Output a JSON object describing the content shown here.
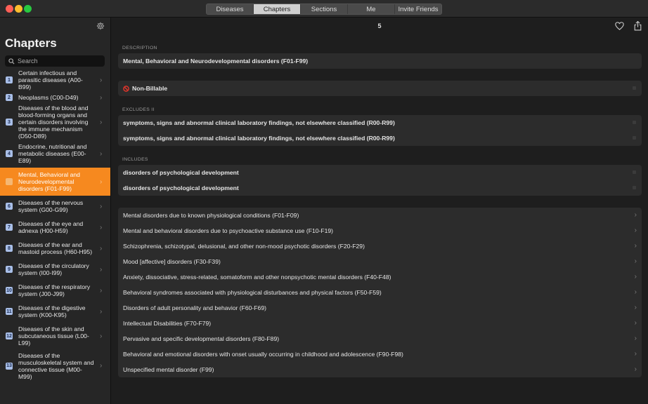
{
  "tabs": [
    {
      "label": "Diseases"
    },
    {
      "label": "Chapters"
    },
    {
      "label": "Sections"
    },
    {
      "label": "Me"
    },
    {
      "label": "Invite Friends"
    }
  ],
  "sidebar": {
    "title": "Chapters",
    "search_placeholder": "Search",
    "items": [
      {
        "num": "1",
        "label": "Certain infectious and parasitic diseases (A00-B99)"
      },
      {
        "num": "2",
        "label": "Neoplasms (C00-D49)"
      },
      {
        "num": "3",
        "label": "Diseases of the blood and blood-forming organs and certain disorders involving the immune mechanism (D50-D89)"
      },
      {
        "num": "4",
        "label": "Endocrine, nutritional and metabolic diseases (E00-E89)"
      },
      {
        "num": "5",
        "label": "Mental, Behavioral and Neurodevelopmental disorders (F01-F99)"
      },
      {
        "num": "6",
        "label": "Diseases of the nervous system (G00-G99)"
      },
      {
        "num": "7",
        "label": "Diseases of the eye and adnexa (H00-H59)"
      },
      {
        "num": "8",
        "label": "Diseases of the ear and mastoid process (H60-H95)"
      },
      {
        "num": "9",
        "label": "Diseases of the circulatory system (I00-I99)"
      },
      {
        "num": "10",
        "label": "Diseases of the respiratory system (J00-J99)"
      },
      {
        "num": "11",
        "label": "Diseases of the digestive system (K00-K95)"
      },
      {
        "num": "12",
        "label": "Diseases of the skin and subcutaneous tissue (L00-L99)"
      },
      {
        "num": "13",
        "label": "Diseases of the musculoskeletal system and connective tissue (M00-M99)"
      }
    ]
  },
  "main": {
    "page_number": "5",
    "description_label": "DESCRIPTION",
    "description": "Mental, Behavioral and Neurodevelopmental disorders (F01-F99)",
    "billable": "Non-Billable",
    "excludes_label": "EXCLUDES II",
    "excludes": [
      "symptoms, signs and abnormal clinical laboratory findings, not elsewhere classified (R00-R99)",
      "symptoms, signs and abnormal clinical laboratory findings, not elsewhere classified (R00-R99)"
    ],
    "includes_label": "INCLUDES",
    "includes": [
      "disorders of psychological development",
      "disorders of psychological development"
    ],
    "sections": [
      "Mental disorders due to known physiological conditions (F01-F09)",
      "Mental and behavioral disorders due to psychoactive substance use (F10-F19)",
      "Schizophrenia, schizotypal, delusional, and other non-mood psychotic disorders (F20-F29)",
      "Mood [affective] disorders (F30-F39)",
      "Anxiety, dissociative, stress-related, somatoform and other nonpsychotic mental disorders (F40-F48)",
      "Behavioral syndromes associated with physiological disturbances and physical factors (F50-F59)",
      "Disorders of adult personality and behavior (F60-F69)",
      "Intellectual Disabilities (F70-F79)",
      "Pervasive and specific developmental disorders (F80-F89)",
      "Behavioral and emotional disorders with onset usually occurring in childhood and adolescence (F90-F98)",
      "Unspecified mental disorder (F99)"
    ]
  },
  "icons": [
    "gear-icon",
    "search-icon",
    "heart-icon",
    "share-icon",
    "no-entry-icon",
    "chevron-right-icon"
  ],
  "colors": {
    "accent": "#f6891f",
    "badge": "#a9bfe8",
    "background": "#1e1e1e",
    "card": "#2c2c2c",
    "no_entry": "#e0352b"
  }
}
